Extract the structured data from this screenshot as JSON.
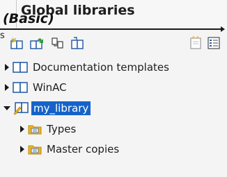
{
  "header": {
    "title": "Global libraries",
    "overlay_label": "(Basic)",
    "stray_char": "s"
  },
  "toolbar": {
    "buttons": [
      {
        "name": "new-library",
        "icon": "new-library-icon"
      },
      {
        "name": "open-library",
        "icon": "open-library-icon"
      },
      {
        "name": "save-library",
        "icon": "save-library-icon"
      },
      {
        "name": "close-library",
        "icon": "close-library-icon"
      },
      {
        "name": "update-library",
        "icon": "update-library-icon"
      },
      {
        "name": "element-view",
        "icon": "element-view-icon"
      }
    ]
  },
  "tree": {
    "items": [
      {
        "label": "Documentation templates",
        "expanded": false,
        "level": 0,
        "icon": "library-book-icon"
      },
      {
        "label": "WinAC",
        "expanded": false,
        "level": 0,
        "icon": "library-book-icon"
      },
      {
        "label": "my_library",
        "expanded": true,
        "level": 0,
        "selected": true,
        "icon": "open-library-edit-icon"
      },
      {
        "label": "Types",
        "expanded": false,
        "level": 1,
        "icon": "types-folder-icon"
      },
      {
        "label": "Master copies",
        "expanded": false,
        "level": 1,
        "icon": "master-copies-folder-icon"
      }
    ]
  },
  "colors": {
    "selection": "#1563c9",
    "folder": "#f2b51b",
    "book": "#2b5fa8"
  }
}
